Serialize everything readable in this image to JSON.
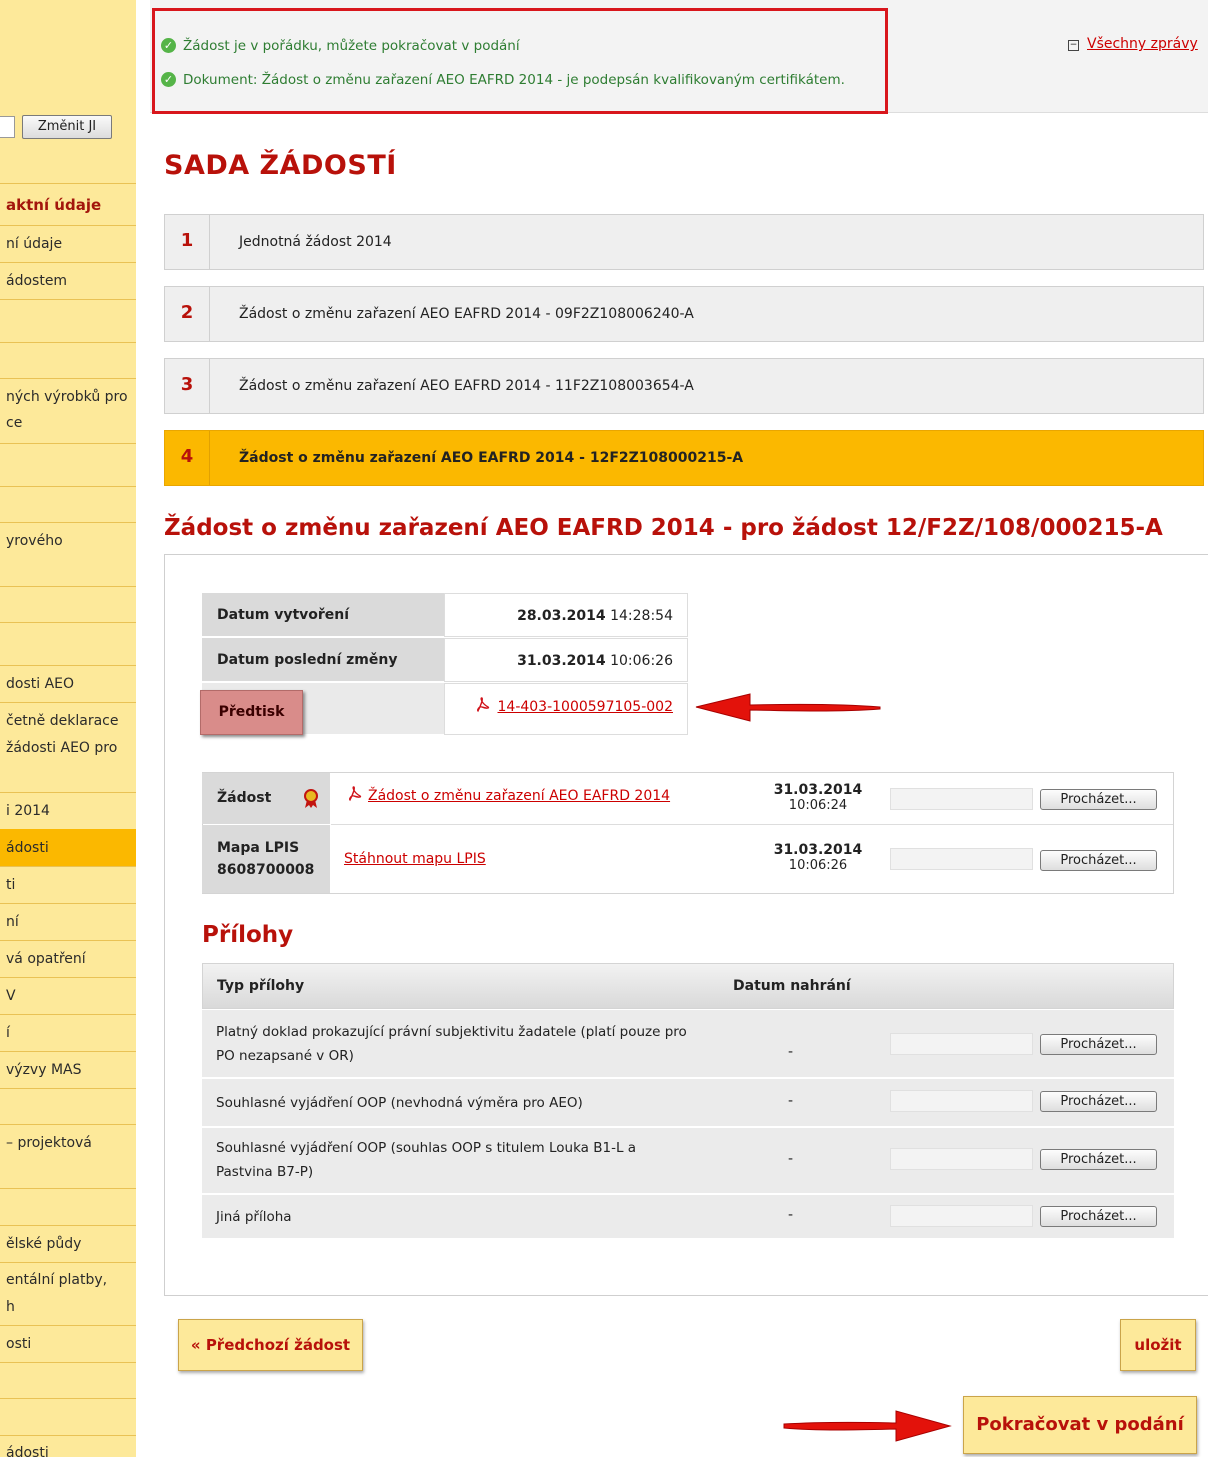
{
  "sidebar": {
    "change_ji_label": "Změnit JI",
    "items": [
      "aktní údaje",
      "ní údaje",
      "ádostem",
      "ných výrobků pro",
      "ce",
      "yrového",
      "dosti AEO",
      "četně deklarace",
      "žádosti AEO pro",
      "i 2014",
      "ádosti",
      "ti",
      "ní",
      "vá opatření",
      "V",
      "í",
      "výzvy MAS",
      "– projektová",
      "ělské půdy",
      "entální platby,",
      "h",
      "osti",
      "ádosti"
    ]
  },
  "messages": {
    "items": [
      "Žádost je v pořádku, můžete pokračovat v podání",
      "Dokument: Žádost o změnu zařazení AEO EAFRD 2014 - je podepsán kvalifikovaným certifikátem."
    ],
    "all_messages_link": "Všechny zprávy"
  },
  "page_title": "SADA ŽÁDOSTÍ",
  "requests": [
    {
      "num": "1",
      "label": "Jednotná žádost 2014"
    },
    {
      "num": "2",
      "label": "Žádost o změnu zařazení AEO EAFRD 2014 - 09F2Z108006240-A"
    },
    {
      "num": "3",
      "label": "Žádost o změnu zařazení AEO EAFRD 2014 - 11F2Z108003654-A"
    },
    {
      "num": "4",
      "label": "Žádost o změnu zařazení AEO EAFRD 2014 - 12F2Z108000215-A"
    }
  ],
  "section_title": "Žádost o změnu zařazení AEO EAFRD 2014 - pro žádost 12/F2Z/108/000215-A",
  "info": {
    "created_label": "Datum vytvoření",
    "created_date": "28.03.2014",
    "created_time": "14:28:54",
    "modified_label": "Datum poslední změny",
    "modified_date": "31.03.2014",
    "modified_time": "10:06:26",
    "predtisk_label": "Předtisk",
    "predtisk_link": "14-403-1000597105-002"
  },
  "files": {
    "zadost_label": "Žádost",
    "zadost_link": "Žádost o změnu zařazení AEO EAFRD 2014",
    "zadost_date": "31.03.2014",
    "zadost_time": "10:06:24",
    "mapa_label_1": "Mapa LPIS",
    "mapa_label_2": "8608700008",
    "mapa_link": "Stáhnout mapu LPIS",
    "mapa_date": "31.03.2014",
    "mapa_time": "10:06:26",
    "browse_label": "Procházet..."
  },
  "attachments": {
    "title": "Přílohy",
    "col_type": "Typ přílohy",
    "col_date": "Datum nahrání",
    "rows": [
      {
        "label": "Platný doklad prokazující právní subjektivitu žadatele (platí pouze pro PO nezapsané v OR)",
        "date": "-"
      },
      {
        "label": "Souhlasné vyjádření OOP (nevhodná výměra pro AEO)",
        "date": "-"
      },
      {
        "label": "Souhlasné vyjádření OOP (souhlas OOP s titulem Louka B1-L a Pastvina B7-P)",
        "date": "-"
      },
      {
        "label": "Jiná příloha",
        "date": "-"
      }
    ]
  },
  "buttons": {
    "prev": "« Předchozí žádost",
    "save": "uložit",
    "continue": "Pokračovat v podání"
  },
  "colors": {
    "brand_red": "#b8110a",
    "active_orange": "#fbb800",
    "sidebar_yellow": "#fde99a",
    "annotation_red": "#d8161c",
    "ok_green": "#55b448"
  },
  "icons": [
    "check-circle-icon",
    "pdf-icon",
    "award-ribbon-icon",
    "minus-box-icon",
    "red-arrow-annotation"
  ]
}
